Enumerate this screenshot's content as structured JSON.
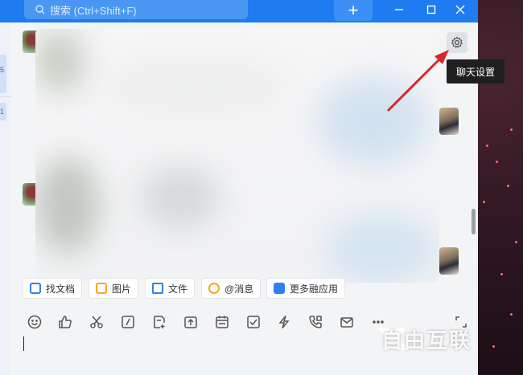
{
  "titlebar": {
    "search_placeholder": "搜索 (Ctrl+Shift+F)",
    "plus_label": "+",
    "accent_color": "#1e7bf0"
  },
  "window_controls": {
    "minimize": "—",
    "maximize": "☐",
    "close": "✕"
  },
  "tooltip": {
    "text": "聊天设置"
  },
  "quick_actions": [
    {
      "label": "找文档",
      "icon": "find-doc-icon",
      "color": "#2f80ed"
    },
    {
      "label": "图片",
      "icon": "image-icon",
      "color": "#f5a623"
    },
    {
      "label": "文件",
      "icon": "folder-icon",
      "color": "#2f80ed"
    },
    {
      "label": "@消息",
      "icon": "at-icon",
      "color": "#f5a623"
    },
    {
      "label": "更多融应用",
      "icon": "apps-icon",
      "color": "#2f80ed"
    }
  ],
  "toolbar_icons": [
    "emoji-icon",
    "thumbs-up-icon",
    "scissors-icon",
    "slash-icon",
    "doc-add-icon",
    "upload-icon",
    "calendar-icon",
    "checkbox-icon",
    "flash-icon",
    "phone-icon",
    "mail-icon",
    "more-icon"
  ],
  "side_tags": [
    "5",
    "1"
  ],
  "watermark": {
    "text": "自由互联"
  }
}
